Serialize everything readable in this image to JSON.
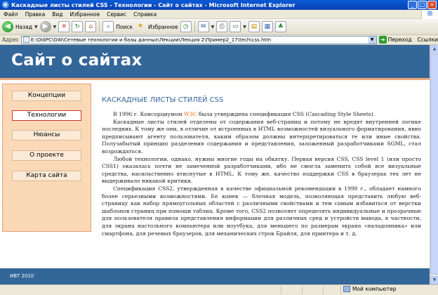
{
  "window": {
    "title": "Каскадные листы стилей CSS - Технологии - Сайт о сайтах - Microsoft Internet Explorer"
  },
  "menu": {
    "items": [
      "Файл",
      "Правка",
      "Вид",
      "Избранное",
      "Сервис",
      "Справка"
    ]
  },
  "toolbar": {
    "back_label": "Назад",
    "search_label": "Поиск",
    "favorites_label": "Избранное"
  },
  "address": {
    "label": "Адрес",
    "url": "E:\\OldPC\\GW\\Сетевые технологии и базы данных\\Лекции\\Лекция 2\\Пример2_17\\tech\\css.htm",
    "go_label": "Переход",
    "links_label": "Ссылки"
  },
  "site": {
    "title": "Сайт о сайтах",
    "nav": [
      {
        "label": "Концепции",
        "active": false
      },
      {
        "label": "Технологии",
        "active": true
      },
      {
        "label": "Нюансы",
        "active": false
      },
      {
        "label": "О проекте",
        "active": false
      },
      {
        "label": "Карта сайта",
        "active": false
      }
    ],
    "footer": "ИВТ 2010"
  },
  "article": {
    "heading": "КАСКАДНЫЕ ЛИСТЫ СТИЛЕЙ CSS",
    "p1_before": "В 1996 г. Консорциумом ",
    "p1_link": "W3C",
    "p1_after": " была утверждена спецификация CSS (Cascading Style Sheets).",
    "p2": "Каскадные листы стилей отделены от содержания веб-страниц и потому не вредят внутренней логике последних. К тому же они, в отличие от встроенных в HTML возможностей визуального форматирования, явно предписывают агенту пользователя, каким образом должны интерпретироваться те или иные свойства. Полузабытый принцип разделения содержания и представления, заложенный разработчиками SGML, стал возрождаться.",
    "p3": "Любой технологии, однако, нужны многие годы на обкатку. Первая версия CSS, CSS level 1 (или просто CSS1) оказалась почти не замеченной разработчиками, ибо не смогла заменить собой все визуальные средства, насильственно втиснутые в HTML. К тому же, качество поддержки CSS в браузерах тех лет не выдерживало никакой критики.",
    "p4": "Спецификация CSS2, утвержденная в качестве официальной рекомендации в 1998 г., обладает намного более серьезными возможностями. Ее конек — блочная модель, позволяющая представить любую веб-страницу как набор прямоугольных областей с различными свойствами и тем самым избавиться от верстки шаблонов страниц при помощи таблиц. Кроме того, CSS2 позволяет определять индивидуальные и прозрачные для пользователя правила представления информации для различных сред и устройств вывода, в частности, для экрана настольного компьютера или ноутбука, для меньшего по размерам экрана «наладонника» или смартфона, для речевых браузеров, для механических строк Брайля, для принтера и т. д."
  },
  "status": {
    "zone": "Мой компьютер"
  },
  "colors": {
    "header_bg": "#336699",
    "sidebar_bg": "#fcd9b6",
    "accent_link": "#ff6600"
  }
}
